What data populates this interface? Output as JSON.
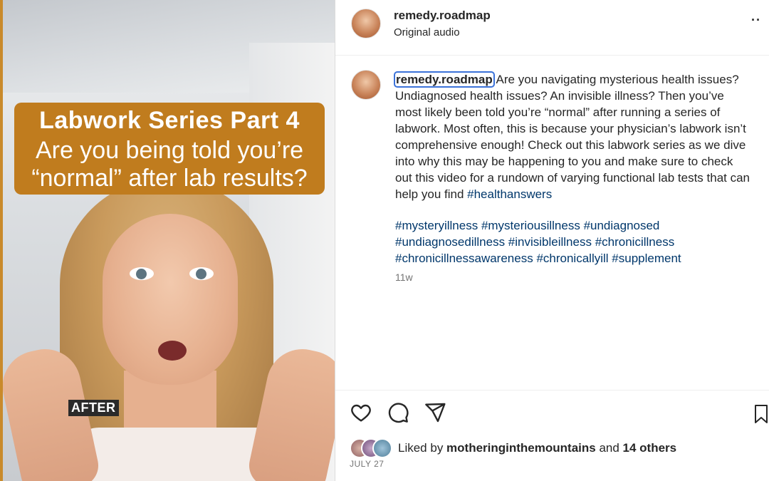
{
  "media": {
    "title_line": "Labwork Series Part 4",
    "sub_line1": "Are you being told you’re",
    "sub_line2": "“normal” after lab results?",
    "after_label": "AFTER",
    "accent_color": "#c07c1e"
  },
  "header": {
    "username": "remedy.roadmap",
    "audio": "Original audio",
    "more": "··"
  },
  "caption": {
    "username": "remedy.roadmap",
    "text": " Are you navigating mysterious health issues? Undiagnosed health issues? An invisible illness? Then you’ve most likely been told you’re “normal” after running a series of labwork. Most often, this is because your physician’s labwork isn’t comprehensive enough! Check out this labwork series as we dive into why this may be happening to you and make sure to check out this video for a rundown of varying functional lab tests that can help you find ",
    "inline_tag": "#healthanswers",
    "hashtags": [
      "#mysteryillness",
      "#mysteriousillness",
      "#undiagnosed",
      "#undiagnosedillness",
      "#invisibleillness",
      "#chronicillness",
      "#chronicillnessawareness",
      "#chronicallyill",
      "#supplement"
    ],
    "age": "11w"
  },
  "likes": {
    "prefix": "Liked by ",
    "user": "mothering in the mountains",
    "user_display": "motheringinthemountains",
    "middle": " and ",
    "others": "14 others"
  },
  "date": "JULY 27",
  "icons": {
    "like": "heart-icon",
    "comment": "comment-icon",
    "share": "share-icon",
    "save": "bookmark-icon"
  }
}
